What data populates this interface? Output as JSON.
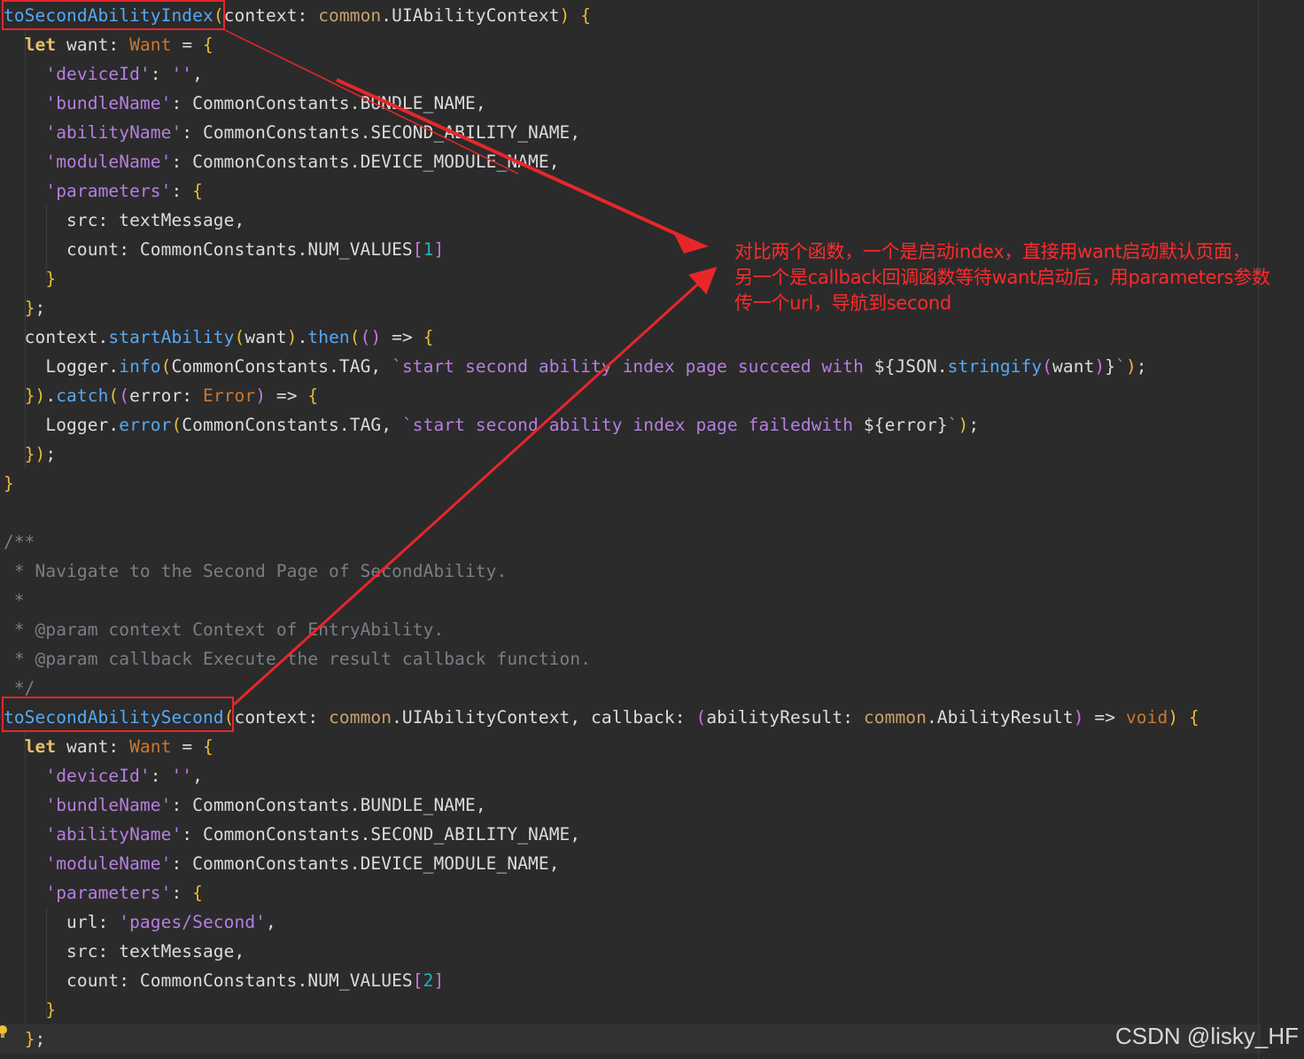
{
  "colors": {
    "background": "#2b2b2b",
    "annotation_red": "#ff2a2a",
    "box_red": "#e8262a"
  },
  "code": {
    "lines": [
      [
        {
          "t": "toSecondAbilityIndex",
          "c": "fn"
        },
        {
          "t": "(",
          "c": "br1"
        },
        {
          "t": "context: ",
          "c": "id"
        },
        {
          "t": "common",
          "c": "mod"
        },
        {
          "t": ".UIAbilityContext",
          "c": "id"
        },
        {
          "t": ") ",
          "c": "br1"
        },
        {
          "t": "{",
          "c": "br1"
        }
      ],
      [
        {
          "t": "  "
        },
        {
          "t": "let",
          "c": "let"
        },
        {
          "t": " want: ",
          "c": "id"
        },
        {
          "t": "Want",
          "c": "type"
        },
        {
          "t": " = ",
          "c": "id"
        },
        {
          "t": "{",
          "c": "br1"
        }
      ],
      [
        {
          "t": "    "
        },
        {
          "t": "'deviceId'",
          "c": "str"
        },
        {
          "t": ": ",
          "c": "id"
        },
        {
          "t": "''",
          "c": "str"
        },
        {
          "t": ",",
          "c": "id"
        }
      ],
      [
        {
          "t": "    "
        },
        {
          "t": "'bundleName'",
          "c": "str"
        },
        {
          "t": ": CommonConstants.BUNDLE_NAME,",
          "c": "id"
        }
      ],
      [
        {
          "t": "    "
        },
        {
          "t": "'abilityName'",
          "c": "str"
        },
        {
          "t": ": CommonConstants.SECOND_ABILITY_NAME,",
          "c": "id"
        }
      ],
      [
        {
          "t": "    "
        },
        {
          "t": "'moduleName'",
          "c": "str"
        },
        {
          "t": ": CommonConstants.DEVICE_MODULE_NAME,",
          "c": "id"
        }
      ],
      [
        {
          "t": "    "
        },
        {
          "t": "'parameters'",
          "c": "str"
        },
        {
          "t": ": ",
          "c": "id"
        },
        {
          "t": "{",
          "c": "br1"
        }
      ],
      [
        {
          "t": "      src: textMessage,",
          "c": "id"
        }
      ],
      [
        {
          "t": "      count: CommonConstants.NUM_VALUES",
          "c": "id"
        },
        {
          "t": "[",
          "c": "br2"
        },
        {
          "t": "1",
          "c": "num"
        },
        {
          "t": "]",
          "c": "br2"
        }
      ],
      [
        {
          "t": "    "
        },
        {
          "t": "}",
          "c": "br1"
        }
      ],
      [
        {
          "t": "  "
        },
        {
          "t": "}",
          "c": "br1"
        },
        {
          "t": ";",
          "c": "id"
        }
      ],
      [
        {
          "t": "  context.",
          "c": "id"
        },
        {
          "t": "startAbility",
          "c": "fn"
        },
        {
          "t": "(",
          "c": "br1"
        },
        {
          "t": "want",
          "c": "id"
        },
        {
          "t": ")",
          "c": "br1"
        },
        {
          "t": ".",
          "c": "id"
        },
        {
          "t": "then",
          "c": "fn"
        },
        {
          "t": "(",
          "c": "br1"
        },
        {
          "t": "()",
          "c": "br2"
        },
        {
          "t": " => ",
          "c": "id"
        },
        {
          "t": "{",
          "c": "br1"
        }
      ],
      [
        {
          "t": "    Logger.",
          "c": "id"
        },
        {
          "t": "info",
          "c": "fn"
        },
        {
          "t": "(",
          "c": "br1"
        },
        {
          "t": "CommonConstants.TAG, ",
          "c": "id"
        },
        {
          "t": "`start second ability index page succeed with ",
          "c": "str"
        },
        {
          "t": "${",
          "c": "id"
        },
        {
          "t": "JSON.",
          "c": "id"
        },
        {
          "t": "stringify",
          "c": "fn"
        },
        {
          "t": "(",
          "c": "br2"
        },
        {
          "t": "want",
          "c": "id"
        },
        {
          "t": ")",
          "c": "br2"
        },
        {
          "t": "}",
          "c": "id"
        },
        {
          "t": "`",
          "c": "str"
        },
        {
          "t": ")",
          "c": "br1"
        },
        {
          "t": ";",
          "c": "id"
        }
      ],
      [
        {
          "t": "  "
        },
        {
          "t": "})",
          "c": "br1"
        },
        {
          "t": ".",
          "c": "id"
        },
        {
          "t": "catch",
          "c": "fn"
        },
        {
          "t": "(",
          "c": "br1"
        },
        {
          "t": "(",
          "c": "br2"
        },
        {
          "t": "error: ",
          "c": "id"
        },
        {
          "t": "Error",
          "c": "type"
        },
        {
          "t": ")",
          "c": "br2"
        },
        {
          "t": " => ",
          "c": "id"
        },
        {
          "t": "{",
          "c": "br1"
        }
      ],
      [
        {
          "t": "    Logger.",
          "c": "id"
        },
        {
          "t": "error",
          "c": "fn"
        },
        {
          "t": "(",
          "c": "br1"
        },
        {
          "t": "CommonConstants.TAG, ",
          "c": "id"
        },
        {
          "t": "`start second ability index page failedwith ",
          "c": "str"
        },
        {
          "t": "${",
          "c": "id"
        },
        {
          "t": "error",
          "c": "id"
        },
        {
          "t": "}",
          "c": "id"
        },
        {
          "t": "`",
          "c": "str"
        },
        {
          "t": ")",
          "c": "br1"
        },
        {
          "t": ";",
          "c": "id"
        }
      ],
      [
        {
          "t": "  "
        },
        {
          "t": "})",
          "c": "br1"
        },
        {
          "t": ";",
          "c": "id"
        }
      ],
      [
        {
          "t": "}",
          "c": "br1"
        }
      ],
      [],
      [
        {
          "t": "/**",
          "c": "cmt"
        }
      ],
      [
        {
          "t": " * Navigate to the Second Page of SecondAbility.",
          "c": "cmt"
        }
      ],
      [
        {
          "t": " *",
          "c": "cmt"
        }
      ],
      [
        {
          "t": " * @param context Context of EntryAbility.",
          "c": "cmt"
        }
      ],
      [
        {
          "t": " * @param callback Execute the result callback function.",
          "c": "cmt"
        }
      ],
      [
        {
          "t": " */",
          "c": "cmt"
        }
      ],
      [
        {
          "t": "toSecondAbilitySecond",
          "c": "fn"
        },
        {
          "t": "(",
          "c": "br1"
        },
        {
          "t": "context: ",
          "c": "id"
        },
        {
          "t": "common",
          "c": "mod"
        },
        {
          "t": ".UIAbilityContext, callback: ",
          "c": "id"
        },
        {
          "t": "(",
          "c": "br2"
        },
        {
          "t": "abilityResult: ",
          "c": "id"
        },
        {
          "t": "common",
          "c": "mod"
        },
        {
          "t": ".AbilityResult",
          "c": "id"
        },
        {
          "t": ")",
          "c": "br2"
        },
        {
          "t": " => ",
          "c": "id"
        },
        {
          "t": "void",
          "c": "type"
        },
        {
          "t": ") ",
          "c": "br1"
        },
        {
          "t": "{",
          "c": "br1"
        }
      ],
      [
        {
          "t": "  "
        },
        {
          "t": "let",
          "c": "let"
        },
        {
          "t": " want: ",
          "c": "id"
        },
        {
          "t": "Want",
          "c": "type"
        },
        {
          "t": " = ",
          "c": "id"
        },
        {
          "t": "{",
          "c": "br1"
        }
      ],
      [
        {
          "t": "    "
        },
        {
          "t": "'deviceId'",
          "c": "str"
        },
        {
          "t": ": ",
          "c": "id"
        },
        {
          "t": "''",
          "c": "str"
        },
        {
          "t": ",",
          "c": "id"
        }
      ],
      [
        {
          "t": "    "
        },
        {
          "t": "'bundleName'",
          "c": "str"
        },
        {
          "t": ": CommonConstants.BUNDLE_NAME,",
          "c": "id"
        }
      ],
      [
        {
          "t": "    "
        },
        {
          "t": "'abilityName'",
          "c": "str"
        },
        {
          "t": ": CommonConstants.SECOND_ABILITY_NAME,",
          "c": "id"
        }
      ],
      [
        {
          "t": "    "
        },
        {
          "t": "'moduleName'",
          "c": "str"
        },
        {
          "t": ": CommonConstants.DEVICE_MODULE_NAME,",
          "c": "id"
        }
      ],
      [
        {
          "t": "    "
        },
        {
          "t": "'parameters'",
          "c": "str"
        },
        {
          "t": ": ",
          "c": "id"
        },
        {
          "t": "{",
          "c": "br1"
        }
      ],
      [
        {
          "t": "      url: ",
          "c": "id"
        },
        {
          "t": "'pages/Second'",
          "c": "str"
        },
        {
          "t": ",",
          "c": "id"
        }
      ],
      [
        {
          "t": "      src: textMessage,",
          "c": "id"
        }
      ],
      [
        {
          "t": "      count: CommonConstants.NUM_VALUES",
          "c": "id"
        },
        {
          "t": "[",
          "c": "br2"
        },
        {
          "t": "2",
          "c": "num"
        },
        {
          "t": "]",
          "c": "br2"
        }
      ],
      [
        {
          "t": "    "
        },
        {
          "t": "}",
          "c": "br1"
        }
      ],
      [
        {
          "t": "  "
        },
        {
          "t": "}",
          "c": "br1"
        },
        {
          "t": ";",
          "c": "id"
        }
      ]
    ],
    "current_line": 35
  },
  "annotation": {
    "line1": "对比两个函数，一个是启动index，直接用want启动默认页面，",
    "line2": "另一个是callback回调函数等待want启动后，用parameters参数",
    "line3": "传一个url，导航到second"
  },
  "watermark": "CSDN @lisky_HF",
  "icons": {
    "bulb": "lightbulb-icon"
  }
}
